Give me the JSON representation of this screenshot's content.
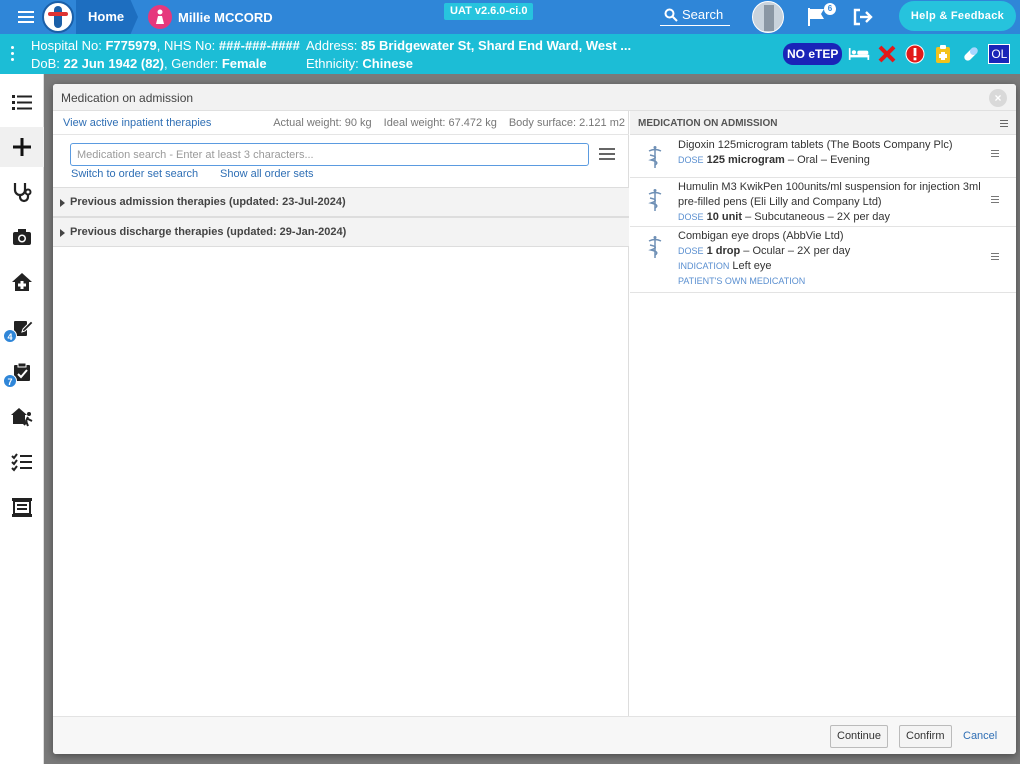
{
  "topbar": {
    "home_label": "Home",
    "patient_name": "Millie MCCORD",
    "env_tag": "UAT v2.6.0-ci.0",
    "search_label": "Search",
    "flag_count": "6",
    "help_label": "Help & Feedback"
  },
  "patient": {
    "hospital_no_label": "Hospital No:",
    "hospital_no": "F775979",
    "nhs_no_label": "NHS No:",
    "nhs_no": "###-###-####",
    "dob_label": "DoB:",
    "dob": "22 Jun 1942 (82)",
    "gender_label": "Gender:",
    "gender": "Female",
    "address_label": "Address:",
    "address": "85 Bridgewater St, Shard End Ward, West ...",
    "ethnicity_label": "Ethnicity:",
    "ethnicity": "Chinese",
    "no_etep": "NO eTEP",
    "ol": "OL"
  },
  "sidebar": {
    "badge_1": "4",
    "badge_2": "7"
  },
  "modal": {
    "title": "Medication on admission",
    "view_active_link": "View active inpatient therapies",
    "actual_weight": "Actual weight: 90 kg",
    "ideal_weight": "Ideal weight: 67.472 kg",
    "body_surface": "Body surface: 2.121 m2",
    "search_placeholder": "Medication search - Enter at least 3 characters...",
    "switch_link": "Switch to order set search",
    "show_all_link": "Show all order sets",
    "accordions": [
      "Previous admission therapies (updated: 23-Jul-2024)",
      "Previous discharge therapies (updated: 29-Jan-2024)"
    ],
    "right_title": "MEDICATION ON ADMISSION",
    "dose_label": "DOSE",
    "indication_label": "INDICATION",
    "meds": [
      {
        "name": "Digoxin 125microgram tablets (The Boots Company Plc)",
        "dose": "125 microgram",
        "route": "– Oral – Evening"
      },
      {
        "name": "Humulin M3 KwikPen 100units/ml suspension for injection 3ml pre-filled pens (Eli Lilly and Company Ltd)",
        "dose": "10 unit",
        "route": "– Subcutaneous – 2X per day"
      },
      {
        "name": "Combigan eye drops (AbbVie Ltd)",
        "dose": "1 drop",
        "route": "– Ocular – 2X per day",
        "indication": "Left eye",
        "pom": "PATIENT'S OWN MEDICATION"
      }
    ],
    "continue_label": "Continue",
    "confirm_label": "Confirm",
    "cancel_label": "Cancel"
  }
}
